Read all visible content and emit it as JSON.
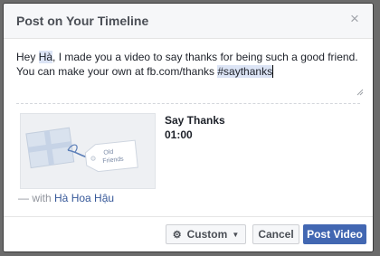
{
  "dialog": {
    "title": "Post on Your Timeline",
    "close_glyph": "×"
  },
  "message": {
    "prefix": "Hey ",
    "mention": "Hà",
    "middle": ", I made you a video to say thanks for being such a good friend. You can make your own at fb.com/thanks ",
    "hashtag": "#saythanks"
  },
  "video": {
    "title": "Say Thanks",
    "duration": "01:00",
    "tag_text": "Old Friends",
    "tag_line_1": "Old",
    "tag_line_2": "Friends"
  },
  "tagged": {
    "prefix": "— with ",
    "name": "Hà Hoa Hậu"
  },
  "footer": {
    "privacy_label": "Custom",
    "privacy_icon": "gear-icon",
    "cancel_label": "Cancel",
    "post_label": "Post Video"
  },
  "colors": {
    "primary": "#4267b2",
    "link": "#365899",
    "highlight": "#dce4f5"
  }
}
